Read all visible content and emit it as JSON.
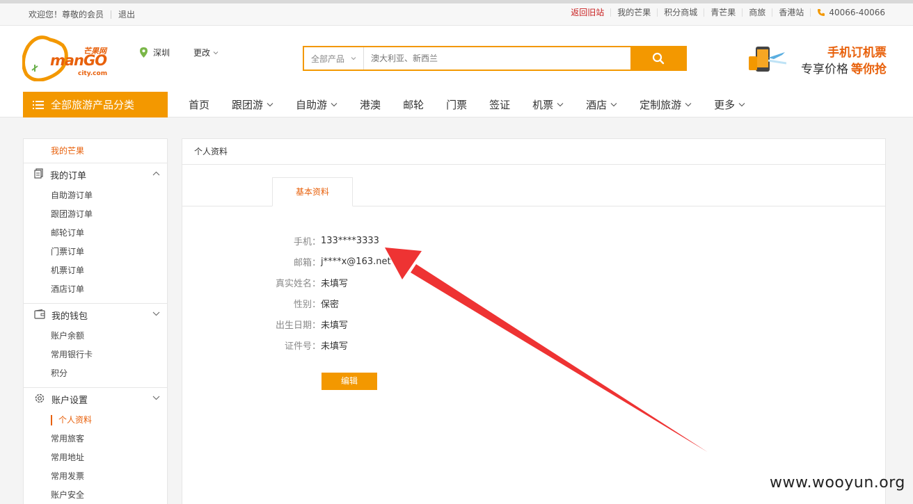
{
  "topbar": {
    "welcome": "欢迎您！尊敬的会员",
    "logout": "退出",
    "links": [
      "返回旧站",
      "我的芒果",
      "积分商城",
      "青芒果",
      "商旅",
      "香港站"
    ],
    "phone": "40066-40066"
  },
  "logo": {
    "cn": "芒果网",
    "word": "manGO",
    "domain": "city.com"
  },
  "location": {
    "city": "深圳",
    "change": "更改"
  },
  "search": {
    "category": "全部产品",
    "placeholder": "澳大利亚、新西兰"
  },
  "ad": {
    "line1": "手机订机票",
    "line2a": "专享价格",
    "line2b": "等你抢"
  },
  "allcat": "全部旅游产品分类",
  "nav": [
    {
      "label": "首页",
      "has_dropdown": false
    },
    {
      "label": "跟团游",
      "has_dropdown": true
    },
    {
      "label": "自助游",
      "has_dropdown": true
    },
    {
      "label": "港澳",
      "has_dropdown": false
    },
    {
      "label": "邮轮",
      "has_dropdown": false
    },
    {
      "label": "门票",
      "has_dropdown": false
    },
    {
      "label": "签证",
      "has_dropdown": false
    },
    {
      "label": "机票",
      "has_dropdown": true
    },
    {
      "label": "酒店",
      "has_dropdown": true
    },
    {
      "label": "定制旅游",
      "has_dropdown": true
    },
    {
      "label": "更多",
      "has_dropdown": true
    }
  ],
  "sidebar": {
    "home": "我的芒果",
    "groups": [
      {
        "title": "我的订单",
        "icon": "order-icon",
        "expanded": true,
        "items": [
          "自助游订单",
          "跟团游订单",
          "邮轮订单",
          "门票订单",
          "机票订单",
          "酒店订单"
        ]
      },
      {
        "title": "我的钱包",
        "icon": "wallet-icon",
        "expanded": false,
        "items": [
          "账户余额",
          "常用银行卡",
          "积分"
        ]
      },
      {
        "title": "账户设置",
        "icon": "gear-icon",
        "expanded": false,
        "items": [
          "个人资料",
          "常用旅客",
          "常用地址",
          "常用发票",
          "账户安全"
        ],
        "active_item": "个人资料"
      }
    ]
  },
  "main": {
    "header": "个人资料",
    "tab": "基本资料",
    "fields": [
      {
        "label": "手机：",
        "value": "133****3333"
      },
      {
        "label": "邮箱：",
        "value": "j****x@163.net"
      },
      {
        "label": "真实姓名：",
        "value": "未填写"
      },
      {
        "label": "性别：",
        "value": "保密"
      },
      {
        "label": "出生日期：",
        "value": "未填写"
      },
      {
        "label": "证件号：",
        "value": "未填写"
      }
    ],
    "edit_button": "编辑"
  },
  "watermark": "www.wooyun.org",
  "colors": {
    "brand": "#f39800",
    "accent": "#e8610c",
    "annotation": "#ee3333"
  }
}
